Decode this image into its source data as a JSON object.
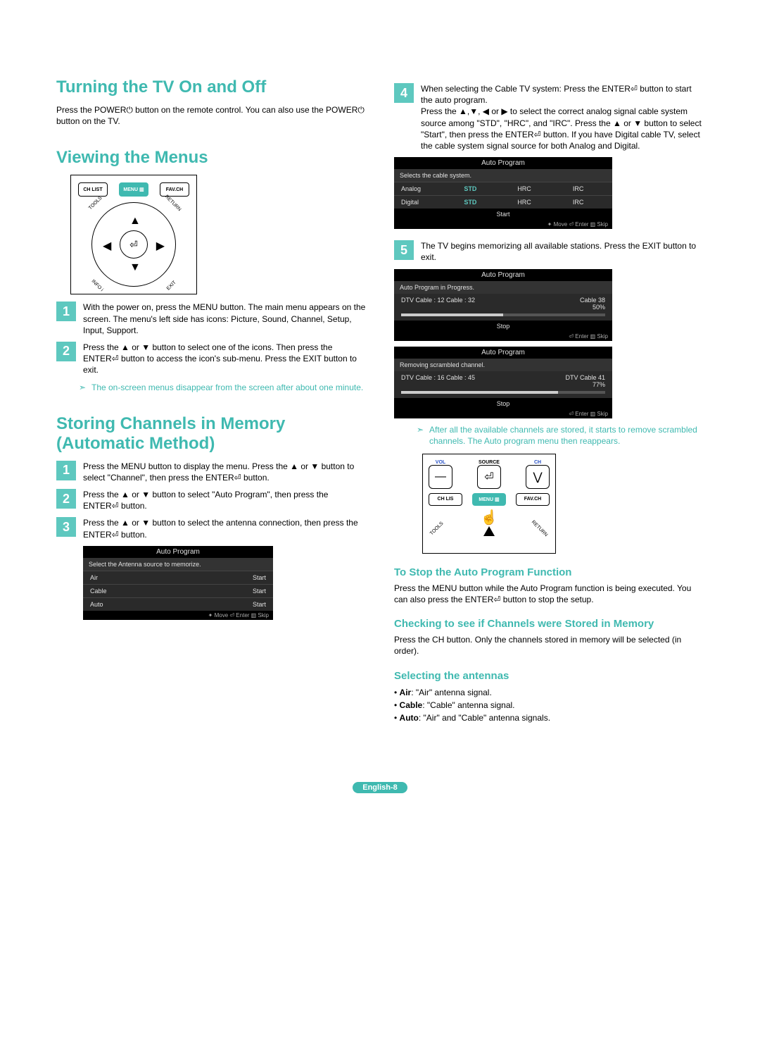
{
  "left": {
    "h_turn": "Turning the TV On and Off",
    "p_turn": "Press the POWER⏻ button on the remote control. You can also use the POWER⏻ button on the TV.",
    "h_menu": "Viewing the Menus",
    "remote": {
      "b1": "CH LIST",
      "b2": "MENU ▥",
      "b3": "FAV.CH",
      "l_tools": "TOOLS",
      "l_return": "RETURN",
      "l_info": "INFO i",
      "l_exit": "EXIT"
    },
    "step1": "With the power on, press the MENU button. The main menu appears on the screen. The menu's left side has icons: Picture, Sound, Channel, Setup, Input, Support.",
    "step2": "Press the ▲ or ▼ button to select one of the icons. Then press the ENTER⏎ button to access the icon's sub-menu. Press the EXIT button to exit.",
    "note1": "The on-screen menus disappear from the screen after about one minute.",
    "h_store": "Storing Channels in Memory (Automatic Method)",
    "s1": "Press the MENU button to display the menu. Press the ▲ or ▼ button to select \"Channel\", then press the ENTER⏎ button.",
    "s2": "Press the ▲ or ▼ button to select \"Auto Program\", then press the ENTER⏎ button.",
    "s3": "Press the ▲ or ▼ button to select the antenna connection, then press the ENTER⏎ button.",
    "osd1": {
      "title": "Auto Program",
      "sub": "Select the Antenna source to memorize.",
      "rows": [
        {
          "l": "Air",
          "r": "Start"
        },
        {
          "l": "Cable",
          "r": "Start"
        },
        {
          "l": "Auto",
          "r": "Start"
        }
      ],
      "foot": "✦ Move   ⏎ Enter   ▥ Skip"
    }
  },
  "right": {
    "s4": "When selecting the Cable TV system: Press the ENTER⏎ button to start the auto program.",
    "s4b": "Press the ▲,▼, ◀ or ▶ to select the correct analog signal cable system source among \"STD\", \"HRC\", and \"IRC\". Press the ▲ or ▼ button to select \"Start\", then press the ENTER⏎ button. If you have Digital cable TV, select the cable system signal source for both Analog and Digital.",
    "osd2": {
      "title": "Auto Program",
      "sub": "Selects the cable system.",
      "r1": {
        "l": "Analog",
        "a": "STD",
        "b": "HRC",
        "c": "IRC"
      },
      "r2": {
        "l": "Digital",
        "a": "STD",
        "b": "HRC",
        "c": "IRC"
      },
      "start": "Start",
      "foot": "✦ Move   ⏎ Enter   ▥ Skip"
    },
    "s5": "The TV begins memorizing all available stations. Press the EXIT button to exit.",
    "osd3": {
      "title": "Auto Program",
      "sub": "Auto Program in Progress.",
      "body": "DTV Cable : 12  Cable : 32",
      "right": "Cable 38\n50%",
      "stop": "Stop",
      "foot": "⏎ Enter   ▥ Skip"
    },
    "osd4": {
      "title": "Auto Program",
      "sub": "Removing scrambled channel.",
      "body": "DTV Cable : 16  Cable : 45",
      "right": "DTV Cable 41\n77%",
      "stop": "Stop",
      "foot": "⏎ Enter   ▥ Skip"
    },
    "note2": "After all the available channels are stored, it starts to remove scrambled channels. The Auto program menu then reappears.",
    "remote2": {
      "vol": "VOL",
      "src": "SOURCE",
      "ch": "CH",
      "minus": "—",
      "enter": "⏎",
      "down": "⋁",
      "chlist": "CH LIS",
      "menu": "MENU ▥",
      "fav": "FAV.CH",
      "tools": "TOOLS",
      "return": "RETURN"
    },
    "h_stop": "To Stop the Auto Program Function",
    "p_stop": "Press the MENU button while the Auto Program function is being executed. You can also press the ENTER⏎ button to stop the setup.",
    "h_check": "Checking to see if Channels were Stored in Memory",
    "p_check": "Press the CH button. Only the channels stored in memory will be selected (in order).",
    "h_ant": "Selecting the antennas",
    "ant": [
      "Air: \"Air\" antenna signal.",
      "Cable: \"Cable\" antenna signal.",
      "Auto: \"Air\" and \"Cable\" antenna signals."
    ]
  },
  "foot": "English-8"
}
